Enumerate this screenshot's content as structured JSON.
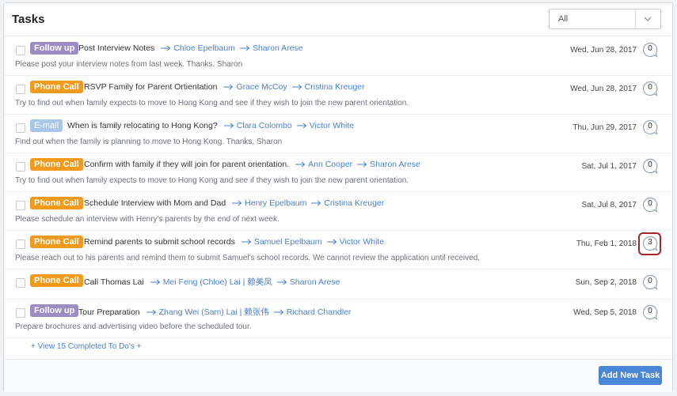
{
  "header": {
    "title": "Tasks",
    "filter_value": "All"
  },
  "tasks": [
    {
      "badge": "Follow up",
      "badge_type": "follow",
      "title": "Post Interview Notes",
      "from": "Chloe Epelbaum",
      "to": "Sharon Arese",
      "description": "Please post your interview notes from last week. Thanks. Sharon",
      "date": "Wed, Jun 28, 2017",
      "comments": "0"
    },
    {
      "badge": "Phone Call",
      "badge_type": "phone",
      "title": "RSVP Family for Parent Ortientation",
      "from": "Grace McCoy",
      "to": "Cristina Kreuger",
      "description": "Try to find out when family expects to move to Hong Kong and see if they wish to join the new parent orientation.",
      "date": "Wed, Jun 28, 2017",
      "comments": "0"
    },
    {
      "badge": "E-mail",
      "badge_type": "email",
      "title": "When is family relocating to Hong Kong?",
      "from": "Clara Colombo",
      "to": "Victor White",
      "description": "Find out when the family is planning to move to Hong Kong. Thanks, Sharon",
      "date": "Thu, Jun 29, 2017",
      "comments": "0"
    },
    {
      "badge": "Phone Call",
      "badge_type": "phone",
      "title": "Confirm with family if they will join for parent orientation.",
      "from": "Ann Cooper",
      "to": "Sharon Arese",
      "description": "Try to find out when family expects to move to Hong Kong and see if they wish to join the new parent orientation.",
      "date": "Sat, Jul 1, 2017",
      "comments": "0"
    },
    {
      "badge": "Phone Call",
      "badge_type": "phone",
      "title": "Schedule Interview with Mom and Dad",
      "from": "Henry Epelbaum",
      "to": "Cristina Kreuger",
      "description": "Please schedule an interview with Henry's parents by the end of next week.",
      "date": "Sat, Jul 8, 2017",
      "comments": "0"
    },
    {
      "badge": "Phone Call",
      "badge_type": "phone",
      "title": "Remind parents to submit school records",
      "from": "Samuel Epelbaum",
      "to": "Victor White",
      "description": "Please reach out to his parents and remind them to submit Samuel's school records. We cannot review the application until received.",
      "date": "Thu, Feb 1, 2018",
      "comments": "3"
    },
    {
      "badge": "Phone Call",
      "badge_type": "phone",
      "title": "Call Thomas Lai",
      "from": "Mei Feng (Chloe) Lai | 赖美凤",
      "to": "Sharon Arese",
      "description": "",
      "date": "Sun, Sep 2, 2018",
      "comments": "0"
    },
    {
      "badge": "Follow up",
      "badge_type": "follow",
      "title": "Tour Preparation",
      "from": "Zhang Wei (Sam) Lai | 赖张伟",
      "to": "Richard Chandler",
      "description": "Prepare brochures and advertising video before the scheduled tour.",
      "date": "Wed, Sep 5, 2018",
      "comments": "0"
    }
  ],
  "view_completed_label": "+ View 15 Completed To Do's +",
  "add_task_label": "Add New Task",
  "colors": {
    "follow_up": "#9b8cc6",
    "phone_call": "#f29a1c",
    "email": "#a7c8ea",
    "link": "#4a7fd1",
    "primary_button": "#4a86d8",
    "highlight": "#a3262d"
  }
}
